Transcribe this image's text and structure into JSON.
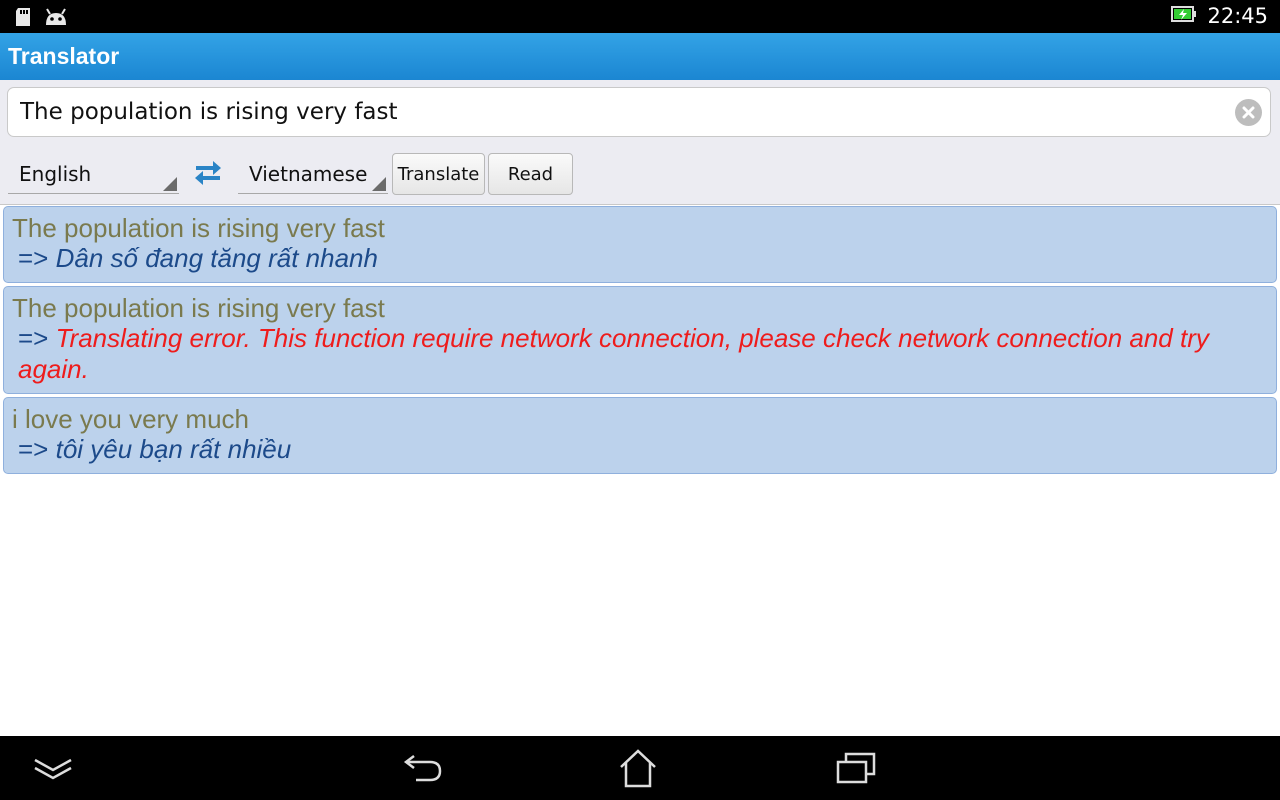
{
  "status_bar": {
    "time": "22:45",
    "left_icons": [
      "sd-card-icon",
      "android-icon"
    ],
    "battery_icon": "battery-charging-icon",
    "battery_color": "#33cc33"
  },
  "app": {
    "title": "Translator",
    "accent_color": "#1f8bd6"
  },
  "input": {
    "value": "The population is rising very fast",
    "clear_icon": "clear-icon"
  },
  "controls": {
    "source_language": "English",
    "target_language": "Vietnamese",
    "swap_icon": "swap-languages-icon",
    "translate_label": "Translate",
    "read_label": "Read"
  },
  "results": [
    {
      "source": "The population is rising very fast",
      "arrow": "=>",
      "translation": "Dân số đang tăng rất nhanh",
      "is_error": false
    },
    {
      "source": "The population is rising very fast",
      "arrow": "=>",
      "translation": "Translating error. This function require network connection, please check network connection and try again.",
      "is_error": true
    },
    {
      "source": "i love you very much",
      "arrow": "=>",
      "translation": "tôi yêu bạn rất nhiều",
      "is_error": false
    }
  ],
  "colors": {
    "result_background": "#bcd2ec",
    "source_text": "#7a7a4e",
    "translation_text": "#1c4a8a",
    "error_text": "#ee1c1c"
  },
  "nav_bar": {
    "icons": [
      "recent-apps-collapse-icon",
      "back-icon",
      "home-icon",
      "recent-apps-icon"
    ]
  }
}
